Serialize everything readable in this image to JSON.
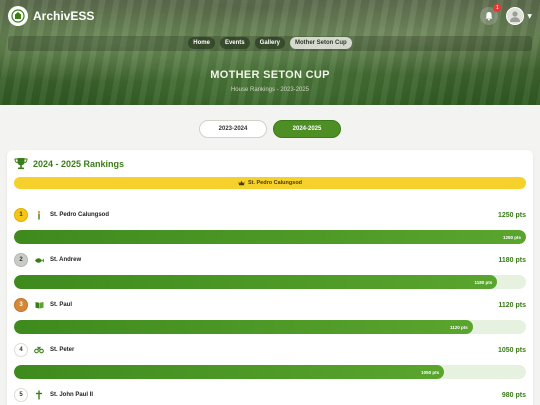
{
  "app": {
    "brand": "ArchivESS",
    "notif_count": "1"
  },
  "breadcrumbs": [
    "Home",
    "Events",
    "Gallery",
    "Mother Seton Cup"
  ],
  "hero": {
    "title": "MOTHER SETON CUP",
    "subtitle": "House Rankings - 2023-2025"
  },
  "years": [
    {
      "label": "2023-2024",
      "active": false
    },
    {
      "label": "2024-2025",
      "active": true
    }
  ],
  "rankings": {
    "title": "2024 - 2025 Rankings",
    "leader": "St. Pedro Calungsod",
    "max_points": 1250,
    "rows": [
      {
        "rank": "1",
        "name": "St. Pedro Calungsod",
        "points": 1250,
        "pts_text": "1250 pts",
        "icon": "torch-icon",
        "medal": "gold"
      },
      {
        "rank": "2",
        "name": "St. Andrew",
        "points": 1180,
        "pts_text": "1180 pts",
        "icon": "fish-icon",
        "medal": "silver"
      },
      {
        "rank": "3",
        "name": "St. Paul",
        "points": 1120,
        "pts_text": "1120 pts",
        "icon": "book-icon",
        "medal": "bronze"
      },
      {
        "rank": "4",
        "name": "St. Peter",
        "points": 1050,
        "pts_text": "1050 pts",
        "icon": "keys-icon",
        "medal": "none"
      },
      {
        "rank": "5",
        "name": "St. John Paul II",
        "points": 980,
        "pts_text": "980 pts",
        "icon": "cross-icon",
        "medal": "none"
      }
    ]
  },
  "colors": {
    "accent": "#3a7d18",
    "bar": "#4d8f24",
    "leader": "#f6d12b"
  }
}
